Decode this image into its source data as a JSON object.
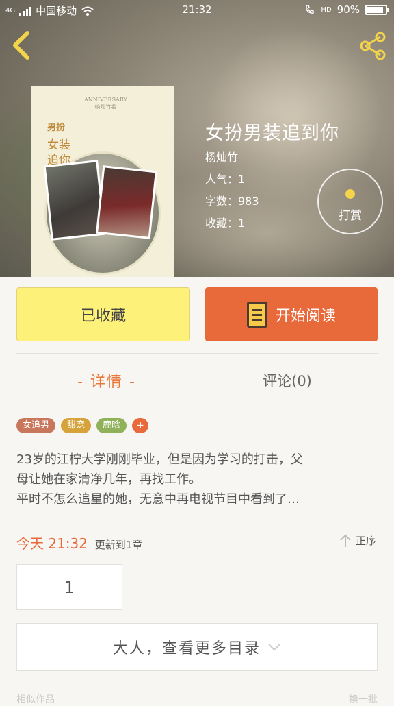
{
  "status_bar": {
    "carrier": "中国移动",
    "network": "4G",
    "time": "21:32",
    "hd": "HD",
    "battery": "90%",
    "battery_level": 0.9
  },
  "book": {
    "title": "女扮男装追到你",
    "author": "杨灿竹",
    "popularity": "人气：1",
    "word_count": "字数：983",
    "favorites": "收藏：1",
    "cover": {
      "caption_line1": "ANNIVERSARY",
      "caption_line2": "杨灿竹著",
      "title_line1": "男扮",
      "title_line2": "女装追你"
    }
  },
  "tip_button": {
    "label": "打赏"
  },
  "actions": {
    "favorite_label": "已收藏",
    "read_label": "开始阅读"
  },
  "tabs": {
    "detail": "- 详情 -",
    "comment": "评论(0)"
  },
  "tags": [
    {
      "label": "女追男",
      "color": "#c8775c"
    },
    {
      "label": "甜宠",
      "color": "#d6a23a"
    },
    {
      "label": "鹿晗",
      "color": "#8fb15a"
    }
  ],
  "tag_more": "+",
  "description": [
    "23岁的江柠大学刚刚毕业，但是因为学习的打击，父",
    "母让她在家清净几年，再找工作。",
    "平时不怎么追星的她，无意中再电视节目中看到了…"
  ],
  "update": {
    "date": "今天 21:32",
    "text": "更新到1章"
  },
  "order_label": "正序",
  "chapters": [
    "1"
  ],
  "more_catalog": "大人，查看更多目录",
  "bottom": {
    "left": "相似作品",
    "right": "换一批"
  },
  "colors": {
    "accent": "#e8693a",
    "favorite_bg": "#fdf17a",
    "share_icon": "#f3d44a"
  }
}
